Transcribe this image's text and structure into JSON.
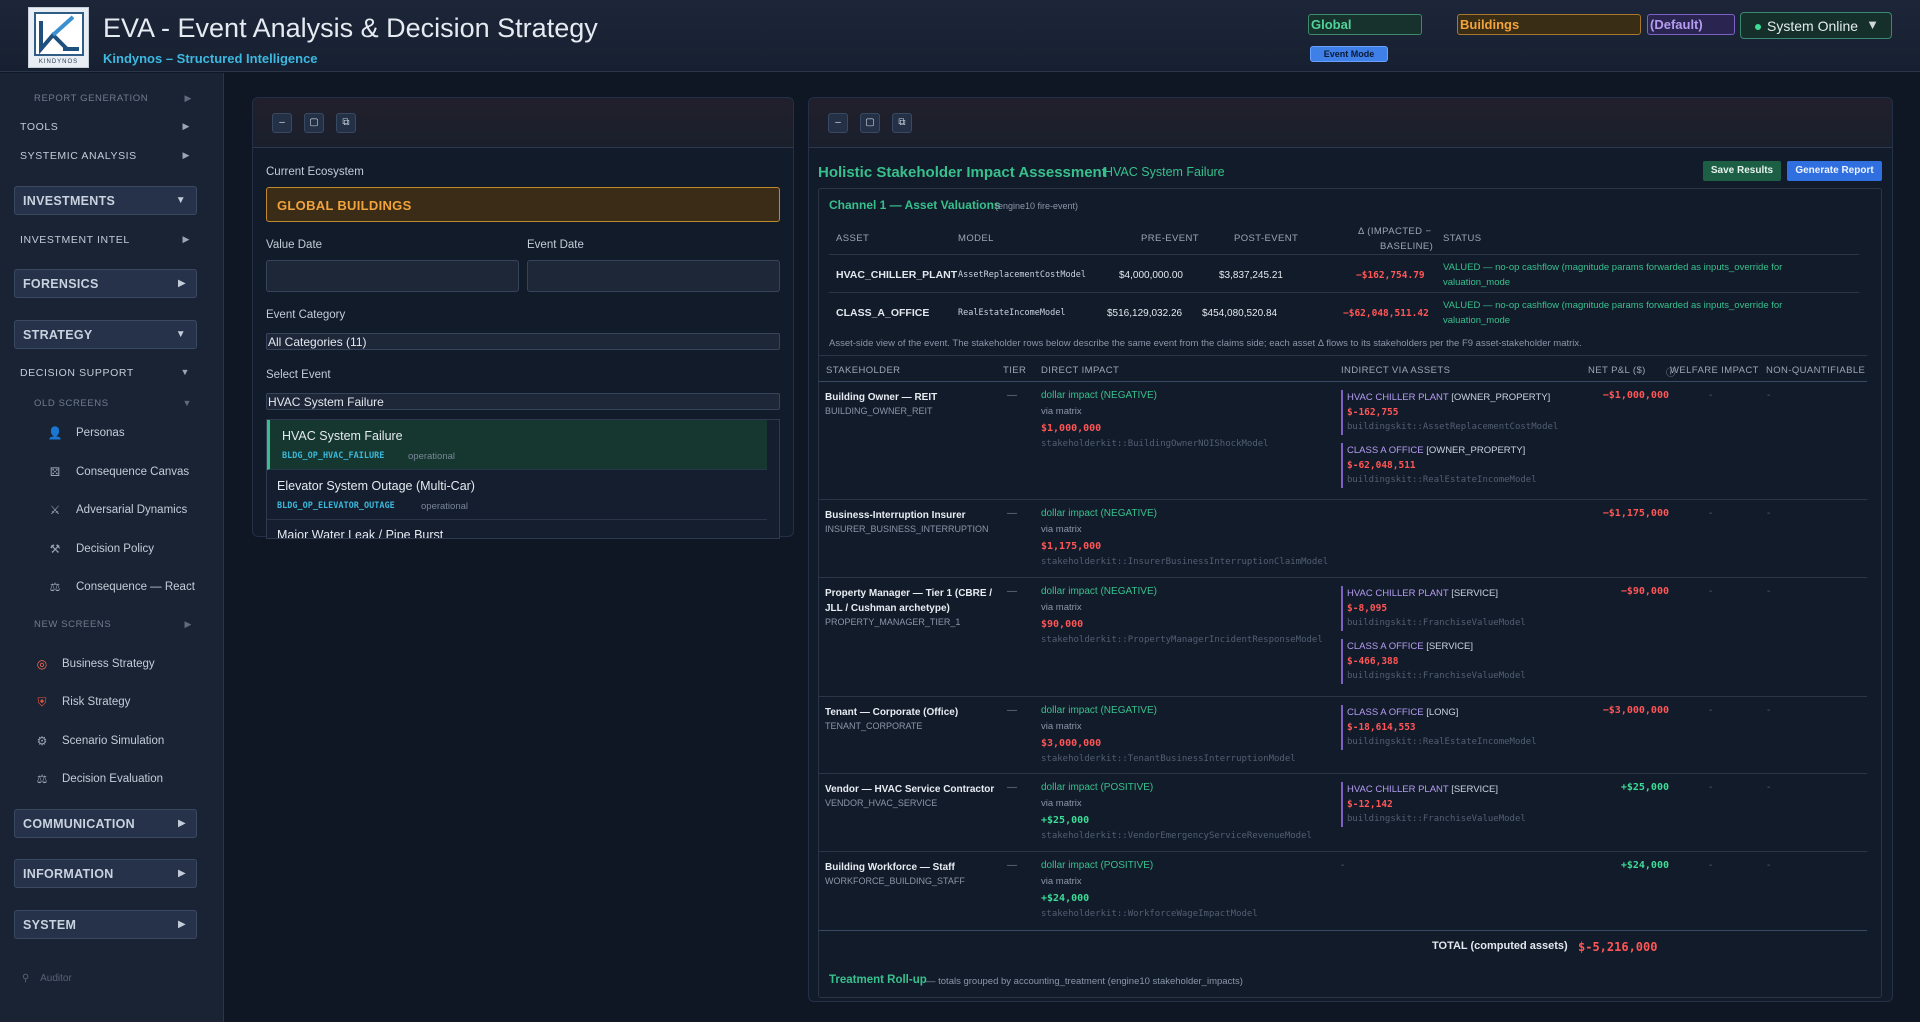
{
  "header": {
    "title": "EVA - Event Analysis & Decision Strategy",
    "subtitle": "Kindynos – Structured Intelligence",
    "logo_text": "KINDYNOS",
    "chips": {
      "global": "Global",
      "buildings": "Buildings",
      "default": "(Default)"
    },
    "status": "System Online",
    "event_mode": "Event Mode",
    "colors": {
      "accent": "#3db8e0",
      "online": "#3ddc97"
    }
  },
  "sidebar": {
    "report_generation": "REPORT GENERATION",
    "tools": "TOOLS",
    "systemic_analysis": "SYSTEMIC ANALYSIS",
    "investments": "INVESTMENTS",
    "investment_intel": "INVESTMENT INTEL",
    "forensics": "FORENSICS",
    "strategy": "STRATEGY",
    "decision_support": "DECISION SUPPORT",
    "old_screens": "OLD SCREENS",
    "old_items": [
      {
        "label": "Personas",
        "icon": "person-icon"
      },
      {
        "label": "Consequence Canvas",
        "icon": "dice-icon"
      },
      {
        "label": "Adversarial Dynamics",
        "icon": "swords-icon"
      },
      {
        "label": "Decision Policy",
        "icon": "hammer-icon"
      },
      {
        "label": "Consequence — React",
        "icon": "scale-icon"
      }
    ],
    "new_screens": "NEW SCREENS",
    "new_items": [
      {
        "label": "Business Strategy",
        "icon": "target-icon"
      },
      {
        "label": "Risk Strategy",
        "icon": "shield-icon"
      },
      {
        "label": "Scenario Simulation",
        "icon": "gear-icon"
      },
      {
        "label": "Decision Evaluation",
        "icon": "scale-icon"
      }
    ],
    "communication": "COMMUNICATION",
    "information": "INFORMATION",
    "system": "SYSTEM",
    "auditor": "Auditor"
  },
  "left_panel": {
    "current_ecosystem_label": "Current Ecosystem",
    "current_ecosystem": "GLOBAL BUILDINGS",
    "value_date_label": "Value Date",
    "event_date_label": "Event Date",
    "event_category_label": "Event Category",
    "event_category": "All Categories (11)",
    "select_event_label": "Select Event",
    "selected_event": "HVAC System Failure",
    "events": [
      {
        "title": "HVAC System Failure",
        "code": "BLDG_OP_HVAC_FAILURE",
        "kind": "operational"
      },
      {
        "title": "Elevator System Outage (Multi-Car)",
        "code": "BLDG_OP_ELEVATOR_OUTAGE",
        "kind": "operational"
      },
      {
        "title": "Major Water Leak / Pipe Burst",
        "code": "",
        "kind": ""
      }
    ]
  },
  "right_panel": {
    "title": "Holistic Stakeholder Impact Assessment",
    "event_name": "HVAC System Failure",
    "save_label": "Save Results",
    "generate_label": "Generate Report",
    "channel_title": "Channel 1 — Asset Valuations",
    "channel_sub": "(engine10 fire-event)",
    "asset_headers": {
      "asset": "ASSET",
      "model": "MODEL",
      "pre": "PRE-EVENT",
      "post": "POST-EVENT",
      "delta1": "Δ (IMPACTED −",
      "delta2": "BASELINE)",
      "status": "STATUS"
    },
    "assets": [
      {
        "asset": "HVAC_CHILLER_PLANT",
        "model": "AssetReplacementCostModel",
        "pre": "$4,000,000.00",
        "post": "$3,837,245.21",
        "delta": "−$162,754.79",
        "status1": "VALUED — no-op cashflow (magnitude params forwarded as inputs_override for",
        "status2": "valuation_mode"
      },
      {
        "asset": "CLASS_A_OFFICE",
        "model": "RealEstateIncomeModel",
        "pre": "$516,129,032.26",
        "post": "$454,080,520.84",
        "delta": "−$62,048,511.42",
        "status1": "VALUED — no-op cashflow (magnitude params forwarded as inputs_override for",
        "status2": "valuation_mode"
      }
    ],
    "asset_note": "Asset-side view of the event. The stakeholder rows below describe the same event from the claims side; each asset Δ flows to its stakeholders per the F9 asset-stakeholder matrix.",
    "sh_headers": {
      "stakeholder": "STAKEHOLDER",
      "tier": "TIER",
      "direct": "DIRECT IMPACT",
      "indirect": "INDIRECT VIA ASSETS",
      "net": "NET P&L ($)",
      "welfare": "WELFARE IMPACT",
      "nonq": "NON-QUANTIFIABLE"
    },
    "stakeholders": [
      {
        "name": "Building Owner — REIT",
        "code": "BUILDING_OWNER_REIT",
        "tier": "—",
        "direct_label": "dollar impact (NEGATIVE)",
        "via": "via matrix",
        "amount": "$1,000,000",
        "model": "stakeholderkit::BuildingOwnerNOIShockModel",
        "net": "−$1,000,000",
        "indirect": [
          {
            "asset": "HVAC CHILLER PLANT",
            "rel": "[OWNER_PROPERTY]",
            "value": "$-162,755",
            "model": "buildingskit::AssetReplacementCostModel"
          },
          {
            "asset": "CLASS A OFFICE",
            "rel": "[OWNER_PROPERTY]",
            "value": "$-62,048,511",
            "model": "buildingskit::RealEstateIncomeModel"
          }
        ]
      },
      {
        "name": "Business-Interruption Insurer",
        "code": "INSURER_BUSINESS_INTERRUPTION",
        "tier": "—",
        "direct_label": "dollar impact (NEGATIVE)",
        "via": "via matrix",
        "amount": "$1,175,000",
        "model": "stakeholderkit::InsurerBusinessInterruptionClaimModel",
        "net": "−$1,175,000",
        "indirect": []
      },
      {
        "name": "Property Manager — Tier 1 (CBRE / JLL / Cushman archetype)",
        "code": "PROPERTY_MANAGER_TIER_1",
        "tier": "—",
        "direct_label": "dollar impact (NEGATIVE)",
        "via": "via matrix",
        "amount": "$90,000",
        "model": "stakeholderkit::PropertyManagerIncidentResponseModel",
        "net": "−$90,000",
        "indirect": [
          {
            "asset": "HVAC CHILLER PLANT",
            "rel": "[SERVICE]",
            "value": "$-8,095",
            "model": "buildingskit::FranchiseValueModel"
          },
          {
            "asset": "CLASS A OFFICE",
            "rel": "[SERVICE]",
            "value": "$-466,388",
            "model": "buildingskit::FranchiseValueModel"
          }
        ]
      },
      {
        "name": "Tenant — Corporate (Office)",
        "code": "TENANT_CORPORATE",
        "tier": "—",
        "direct_label": "dollar impact (NEGATIVE)",
        "via": "via matrix",
        "amount": "$3,000,000",
        "model": "stakeholderkit::TenantBusinessInterruptionModel",
        "net": "−$3,000,000",
        "indirect": [
          {
            "asset": "CLASS A OFFICE",
            "rel": "[LONG]",
            "value": "$-18,614,553",
            "model": "buildingskit::RealEstateIncomeModel"
          }
        ]
      },
      {
        "name": "Vendor — HVAC Service Contractor",
        "code": "VENDOR_HVAC_SERVICE",
        "tier": "—",
        "direct_label": "dollar impact (POSITIVE)",
        "via": "via matrix",
        "amount": "+$25,000",
        "model": "stakeholderkit::VendorEmergencyServiceRevenueModel",
        "net": "+$25,000",
        "indirect": [
          {
            "asset": "HVAC CHILLER PLANT",
            "rel": "[SERVICE]",
            "value": "$-12,142",
            "model": "buildingskit::FranchiseValueModel"
          }
        ]
      },
      {
        "name": "Building Workforce — Staff",
        "code": "WORKFORCE_BUILDING_STAFF",
        "tier": "—",
        "direct_label": "dollar impact (POSITIVE)",
        "via": "via matrix",
        "amount": "+$24,000",
        "model": "stakeholderkit::WorkforceWageImpactModel",
        "net": "+$24,000",
        "indirect": []
      }
    ],
    "dash": "-",
    "total_label": "TOTAL (computed assets)",
    "total_value": "$-5,216,000",
    "rollup_title": "Treatment Roll-up",
    "rollup_sub": "— totals grouped by accounting_treatment (engine10 stakeholder_impacts)"
  }
}
